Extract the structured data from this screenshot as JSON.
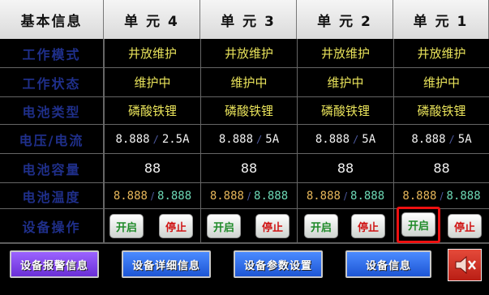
{
  "header": {
    "title": "基本信息",
    "units": [
      "单 元 4",
      "单 元 3",
      "单 元 2",
      "单 元 1"
    ]
  },
  "rows": {
    "labels": [
      "工作模式",
      "工作状态",
      "电池类型",
      "电压/电流",
      "电池容量",
      "电池温度",
      "设备操作"
    ],
    "work_mode": [
      "井放维护",
      "井放维护",
      "井放维护",
      "井放维护"
    ],
    "work_status": [
      "维护中",
      "维护中",
      "维护中",
      "维护中"
    ],
    "battery_type": [
      "磷酸铁锂",
      "磷酸铁锂",
      "磷酸铁锂",
      "磷酸铁锂"
    ],
    "voltage": [
      "8.888",
      "8.888",
      "8.888",
      "8.888"
    ],
    "current": [
      "2.5A",
      "5A",
      "5A",
      "5A"
    ],
    "capacity": [
      "88",
      "88",
      "88",
      "88"
    ],
    "temp_a": [
      "8.888",
      "8.888",
      "8.888",
      "8.888"
    ],
    "temp_b": [
      "8.888",
      "8.888",
      "8.888",
      "8.888"
    ],
    "start_label": "开启",
    "stop_label": "停止"
  },
  "nav": {
    "alarm": "设备报警信息",
    "detail": "设备详细信息",
    "params": "设备参数设置",
    "info": "设备信息"
  },
  "icons": {
    "mute": "speaker-muted-icon"
  },
  "colors": {
    "selected": "#e11111",
    "nav_purple": "#7a3ee0",
    "nav_blue": "#1e58d8"
  }
}
